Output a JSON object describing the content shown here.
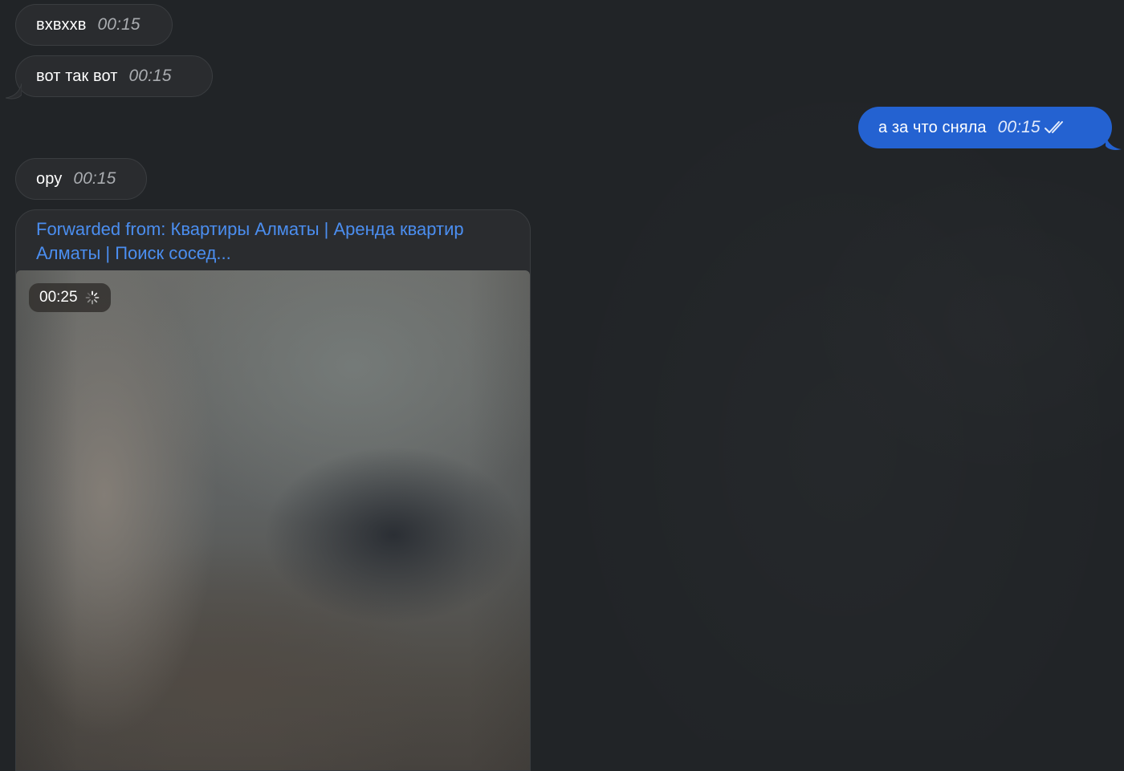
{
  "messages": [
    {
      "text": "вхвххв",
      "time": "00:15"
    },
    {
      "text": "вот так вот",
      "time": "00:15"
    },
    {
      "text": "а за что сняла",
      "time": "00:15"
    },
    {
      "text": "ору",
      "time": "00:15"
    }
  ],
  "forwarded": {
    "prefix": "Forwarded from: ",
    "source": "Квартиры Алматы | Аренда квартир Алматы | Поиск сосед...",
    "video_duration": "00:25"
  },
  "colors": {
    "background": "#212427",
    "incoming_bubble": "#2a2c2f",
    "outgoing_bubble": "#2462d1",
    "link": "#4b8ef0"
  },
  "icons": {
    "read_status": "double-check-icon",
    "loading": "spinner-icon"
  }
}
